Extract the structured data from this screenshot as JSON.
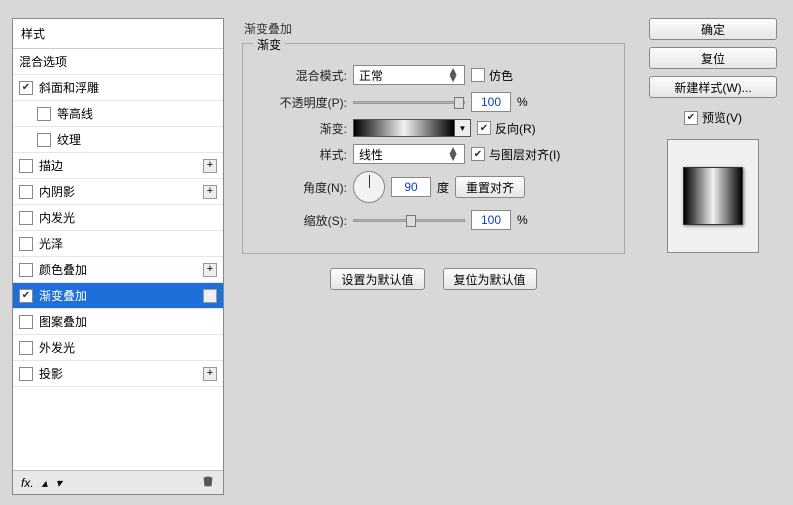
{
  "sidebar": {
    "header": "样式",
    "blend_options": "混合选项",
    "items": [
      {
        "label": "斜面和浮雕",
        "checked": true,
        "plus": false,
        "indent": 0
      },
      {
        "label": "等高线",
        "checked": false,
        "plus": false,
        "indent": 1
      },
      {
        "label": "纹理",
        "checked": false,
        "plus": false,
        "indent": 1
      },
      {
        "label": "描边",
        "checked": false,
        "plus": true,
        "indent": 0
      },
      {
        "label": "内阴影",
        "checked": false,
        "plus": true,
        "indent": 0
      },
      {
        "label": "内发光",
        "checked": false,
        "plus": false,
        "indent": 0
      },
      {
        "label": "光泽",
        "checked": false,
        "plus": false,
        "indent": 0
      },
      {
        "label": "颜色叠加",
        "checked": false,
        "plus": true,
        "indent": 0
      },
      {
        "label": "渐变叠加",
        "checked": true,
        "plus": true,
        "indent": 0,
        "selected": true
      },
      {
        "label": "图案叠加",
        "checked": false,
        "plus": false,
        "indent": 0
      },
      {
        "label": "外发光",
        "checked": false,
        "plus": false,
        "indent": 0
      },
      {
        "label": "投影",
        "checked": false,
        "plus": true,
        "indent": 0
      }
    ],
    "footer_fx": "fx."
  },
  "main": {
    "title": "渐变叠加",
    "group_label": "渐变",
    "blend_mode_label": "混合模式:",
    "blend_mode_value": "正常",
    "dither_label": "仿色",
    "opacity_label": "不透明度(P):",
    "opacity_value": "100",
    "opacity_unit": "%",
    "gradient_label": "渐变:",
    "reverse_label": "反向(R)",
    "style_label": "样式:",
    "style_value": "线性",
    "align_label": "与图层对齐(I)",
    "angle_label": "角度(N):",
    "angle_value": "90",
    "angle_unit": "度",
    "reset_align_btn": "重置对齐",
    "scale_label": "缩放(S):",
    "scale_value": "100",
    "scale_unit": "%",
    "set_default_btn": "设置为默认值",
    "reset_default_btn": "复位为默认值"
  },
  "right": {
    "ok": "确定",
    "cancel": "复位",
    "new_style": "新建样式(W)...",
    "preview_label": "预览(V)"
  }
}
